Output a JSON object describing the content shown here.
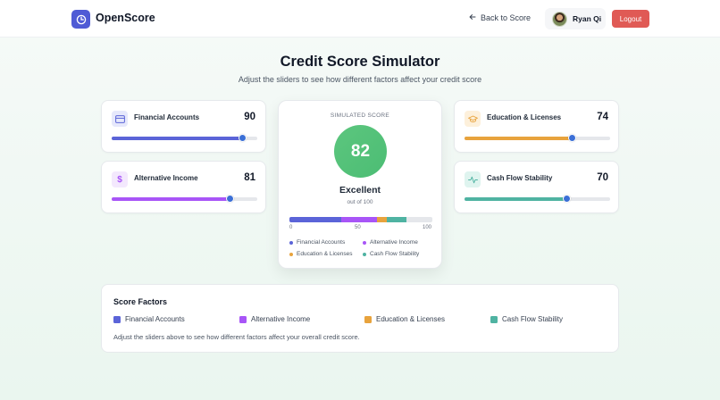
{
  "header": {
    "app_name": "OpenScore",
    "back_label": "Back to Score",
    "user_name": "Ryan Qi",
    "logout_label": "Logout"
  },
  "page": {
    "title": "Credit Score Simulator",
    "subtitle": "Adjust the sliders to see how different factors affect your credit score"
  },
  "factors": [
    {
      "label": "Financial Accounts",
      "value": 90,
      "color": "#5b64d8",
      "icon": "credit-card-icon"
    },
    {
      "label": "Alternative Income",
      "value": 81,
      "color": "#a855f7",
      "icon": "dollar-icon"
    },
    {
      "label": "Education & Licenses",
      "value": 74,
      "color": "#e8a33d",
      "icon": "graduation-cap-icon"
    },
    {
      "label": "Cash Flow Stability",
      "value": 70,
      "color": "#4fb3a2",
      "icon": "activity-icon"
    }
  ],
  "simulated": {
    "label": "SIMULATED SCORE",
    "score": "82",
    "rating": "Excellent",
    "out_of": "out of 100",
    "ticks": [
      "0",
      "50",
      "100"
    ],
    "segments": [
      {
        "name": "Financial Accounts",
        "share": 36,
        "color": "#5b64d8"
      },
      {
        "name": "Alternative Income",
        "share": 25,
        "color": "#a855f7"
      },
      {
        "name": "Education & Licenses",
        "share": 7,
        "color": "#e8a33d"
      },
      {
        "name": "Cash Flow Stability",
        "share": 14,
        "color": "#4fb3a2"
      }
    ],
    "score_color": "#4cbd74"
  },
  "score_factors": {
    "title": "Score Factors",
    "keys": [
      "Financial Accounts",
      "Alternative Income",
      "Education & Licenses",
      "Cash Flow Stability"
    ],
    "note": "Adjust the sliders above to see how different factors affect your overall credit score."
  },
  "colors": {
    "accent": "#4f5bd5",
    "logout": "#e05a55",
    "slider_thumb": "#3b6fd6"
  }
}
